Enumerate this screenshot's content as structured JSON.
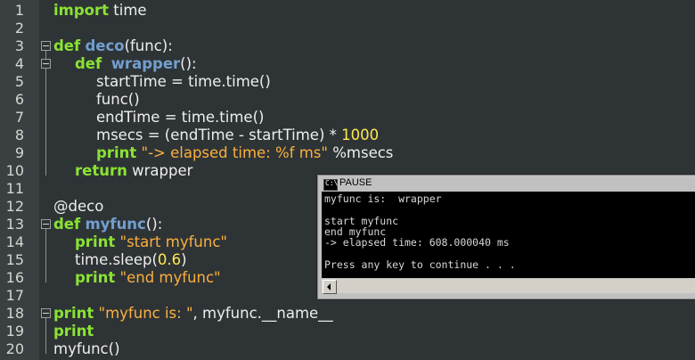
{
  "editor": {
    "line_numbers": [
      "1",
      "2",
      "3",
      "4",
      "5",
      "6",
      "7",
      "8",
      "9",
      "10",
      "11",
      "12",
      "13",
      "14",
      "15",
      "16",
      "17",
      "18",
      "19",
      "20"
    ],
    "lines": {
      "l1": {
        "kw": "import",
        "rest": " time"
      },
      "l3": {
        "kw": "def",
        "fn": "deco",
        "rest": "(func):"
      },
      "l4": {
        "kw": "def",
        "fn": "wrapper",
        "rest": "():"
      },
      "l5": {
        "text": "startTime = time.time()"
      },
      "l6": {
        "text": "func()"
      },
      "l7": {
        "text": "endTime = time.time()"
      },
      "l8": {
        "pre": "msecs = (endTime - startTime) * ",
        "num": "1000"
      },
      "l9": {
        "kw": "print",
        "str": "\"-> elapsed time: %f ms\"",
        "rest": " %msecs"
      },
      "l10": {
        "kw": "return",
        "rest": " wrapper"
      },
      "l12": {
        "text": "@deco"
      },
      "l13": {
        "kw": "def",
        "fn": "myfunc",
        "rest": "():"
      },
      "l14": {
        "kw": "print",
        "str": "\"start myfunc\""
      },
      "l15": {
        "pre": "time.sleep(",
        "num": "0.6",
        "rest": ")"
      },
      "l16": {
        "kw": "print",
        "str": "\"end myfunc\""
      },
      "l18": {
        "kw": "print",
        "str": "\"myfunc is: \"",
        "rest": ", myfunc.__name__"
      },
      "l19": {
        "kw": "print"
      },
      "l20": {
        "text": "myfunc()"
      }
    }
  },
  "console": {
    "title": "PAUSE",
    "icon_text": "C:\\",
    "lines": [
      "myfunc is:  wrapper",
      "",
      "start myfunc",
      "end myfunc",
      "-> elapsed time: 608.000040 ms",
      "",
      "Press any key to continue . . ."
    ]
  }
}
